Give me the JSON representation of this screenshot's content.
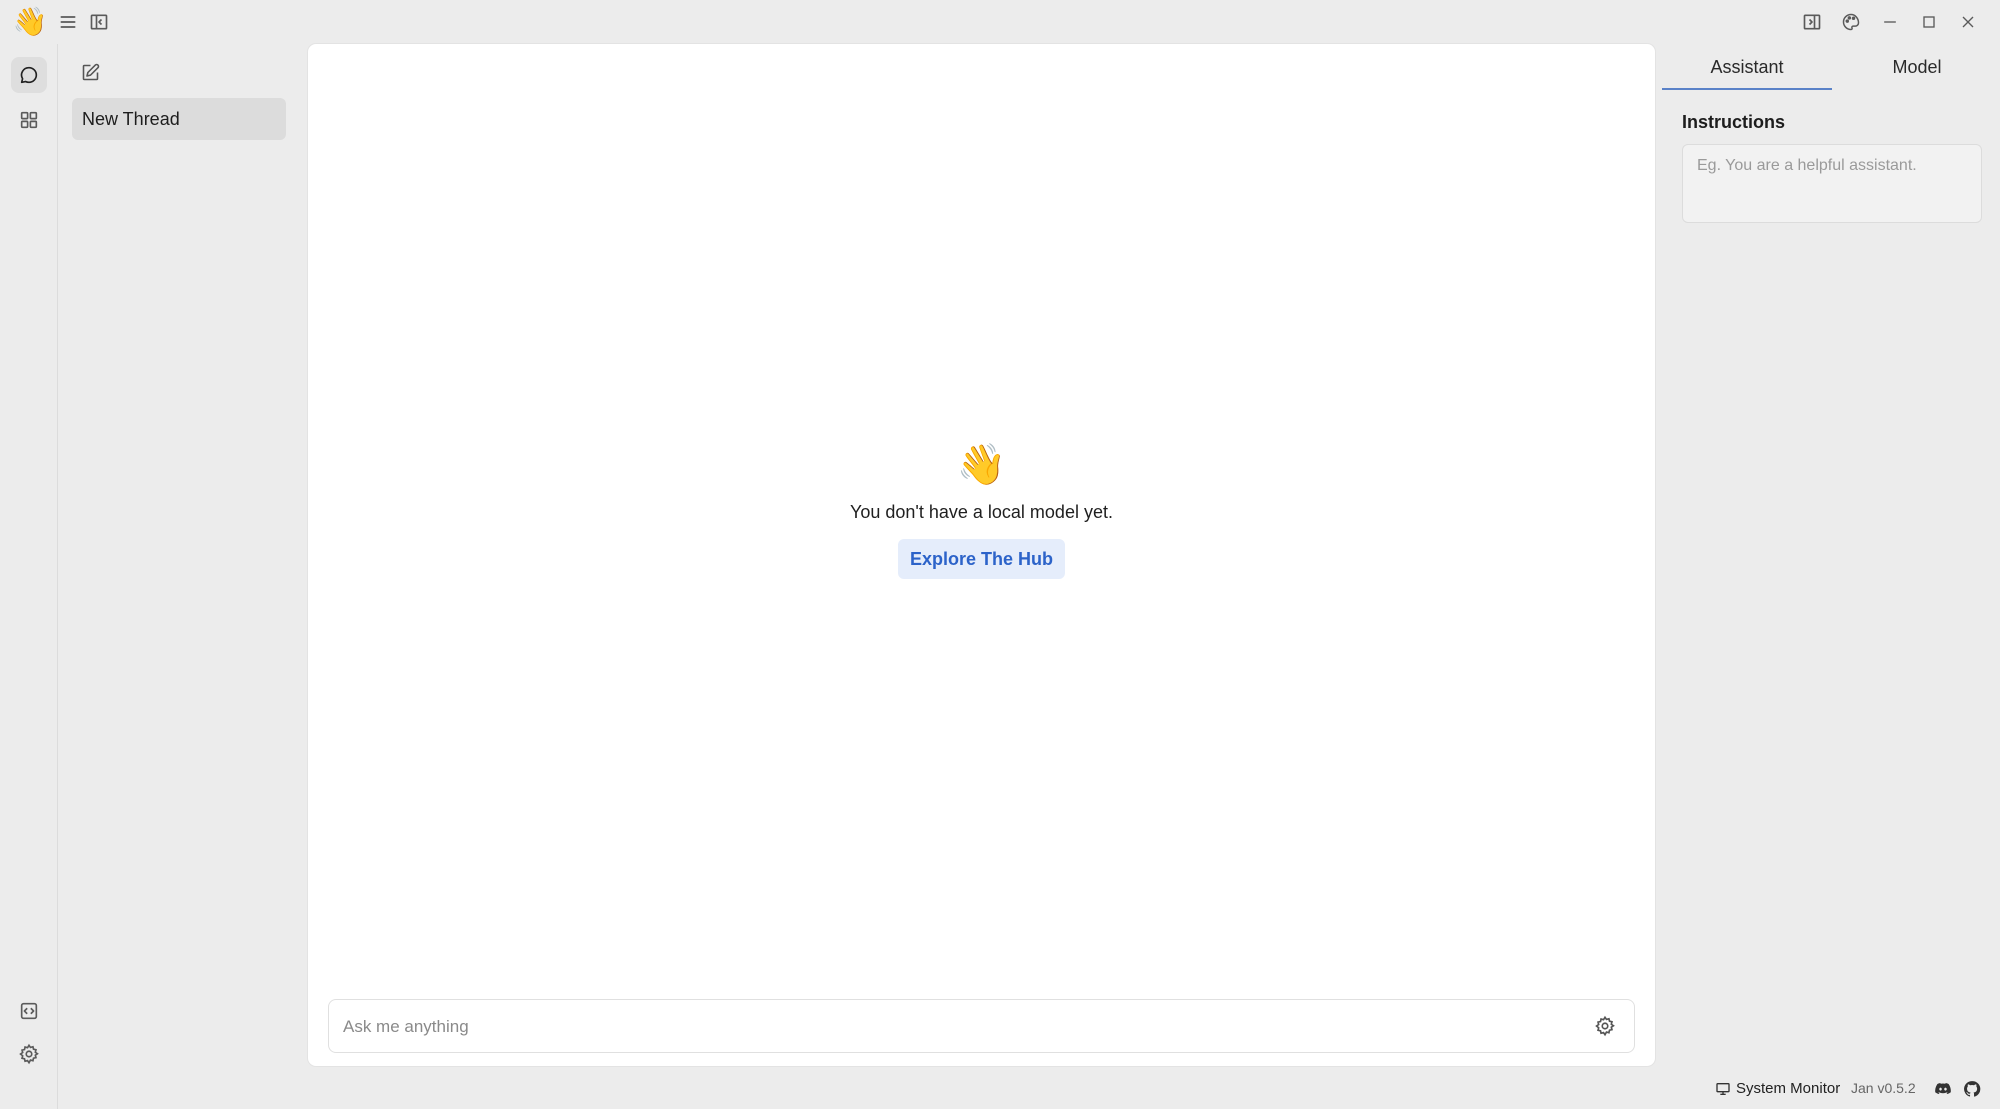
{
  "app": {
    "logo_glyph": "👋",
    "icons": {
      "menu": "hamburger-icon",
      "left_panel_toggle": "panel-left-icon",
      "right_panel_toggle": "panel-right-icon",
      "theme": "palette-icon",
      "minimize": "minimize-icon",
      "maximize": "maximize-icon",
      "close": "close-icon"
    }
  },
  "rail": {
    "items": [
      {
        "name": "chat",
        "icon": "chat-bubble-icon",
        "active": true
      },
      {
        "name": "hub",
        "icon": "grid-icon",
        "active": false
      }
    ],
    "bottom": [
      {
        "name": "local-api-server",
        "icon": "code-box-icon"
      },
      {
        "name": "settings",
        "icon": "gear-icon"
      }
    ]
  },
  "threads": {
    "new_thread_icon": "edit-icon",
    "items": [
      {
        "title": "New Thread",
        "active": true
      }
    ]
  },
  "main": {
    "empty_emoji": "👋",
    "empty_message": "You don't have a local model yet.",
    "hub_button": "Explore The Hub",
    "composer_placeholder": "Ask me anything",
    "composer_settings_icon": "gear-icon"
  },
  "right_panel": {
    "tabs": [
      {
        "label": "Assistant",
        "active": true
      },
      {
        "label": "Model",
        "active": false
      }
    ],
    "instructions_label": "Instructions",
    "instructions_placeholder": "Eg. You are a helpful assistant.",
    "instructions_value": ""
  },
  "status_bar": {
    "system_monitor": "System Monitor",
    "version": "Jan v0.5.2",
    "discord_icon": "discord-icon",
    "github_icon": "github-icon"
  },
  "colors": {
    "background": "#ececec",
    "panel": "#ffffff",
    "accent": "#2c63c9",
    "accent_bg": "#e5edfb",
    "active_tab_underline": "#5a82c8"
  }
}
